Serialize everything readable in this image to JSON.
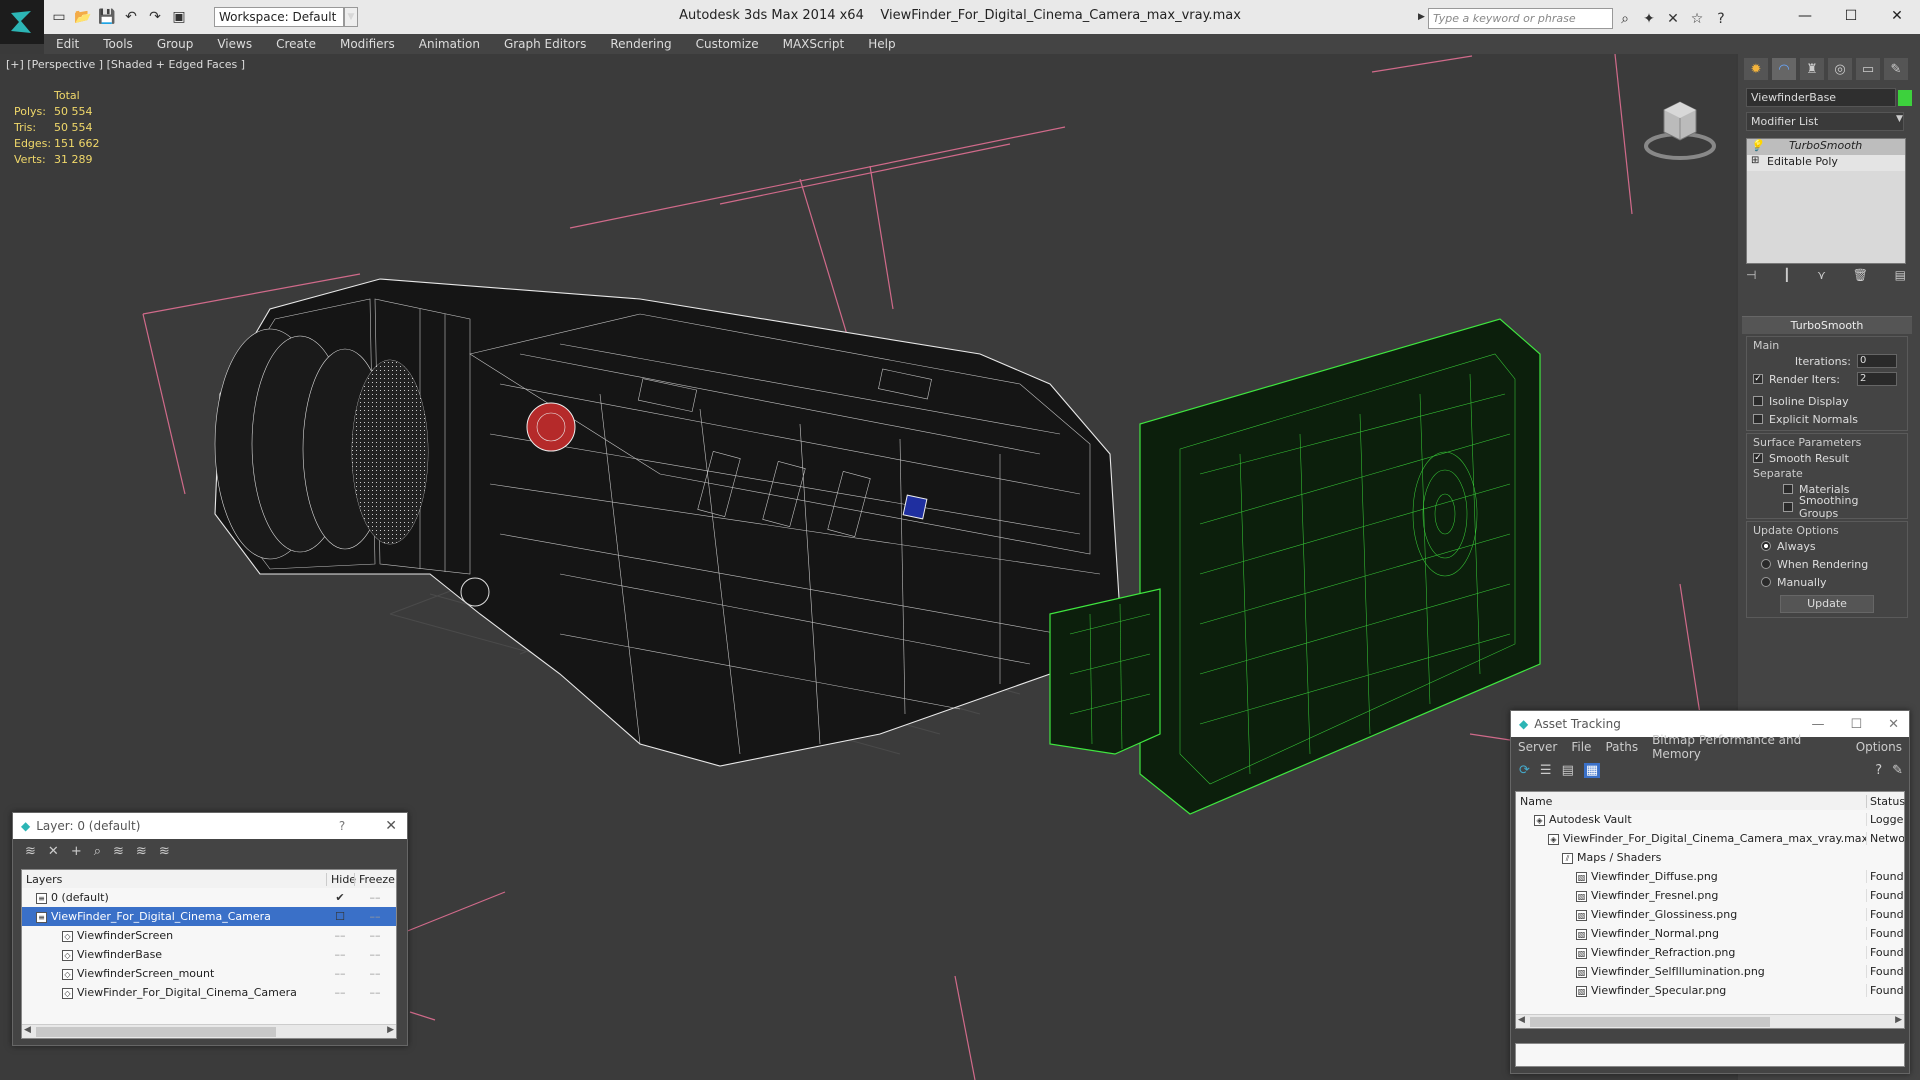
{
  "titlebar": {
    "workspace": "Workspace: Default",
    "app_name": "Autodesk 3ds Max  2014 x64",
    "file_name": "ViewFinder_For_Digital_Cinema_Camera_max_vray.max",
    "search_placeholder": "Type a keyword or phrase"
  },
  "menu": [
    "Edit",
    "Tools",
    "Group",
    "Views",
    "Create",
    "Modifiers",
    "Animation",
    "Graph Editors",
    "Rendering",
    "Customize",
    "MAXScript",
    "Help"
  ],
  "viewport": {
    "label": "[+] [Perspective ] [Shaded + Edged Faces ]",
    "stats": {
      "header": "Total",
      "rows": [
        {
          "label": "Polys:",
          "value": "50 554"
        },
        {
          "label": "Tris:",
          "value": "50 554"
        },
        {
          "label": "Edges:",
          "value": "151 662"
        },
        {
          "label": "Verts:",
          "value": "31 289"
        }
      ]
    }
  },
  "command_panel": {
    "object_name": "ViewfinderBase",
    "object_color": "#3dd13d",
    "modifier_list": "Modifier List",
    "stack": [
      "TurboSmooth",
      "Editable Poly"
    ],
    "rollout_title": "TurboSmooth",
    "main_label": "Main",
    "iterations_label": "Iterations:",
    "iterations_value": "0",
    "render_iters_label": "Render Iters:",
    "render_iters_value": "2",
    "isoline": "Isoline Display",
    "explicit_normals": "Explicit Normals",
    "surface_params": "Surface Parameters",
    "smooth_result": "Smooth Result",
    "separate": "Separate",
    "materials": "Materials",
    "smoothing_groups": "Smoothing Groups",
    "update_options": "Update Options",
    "always": "Always",
    "when_rendering": "When Rendering",
    "manually": "Manually",
    "update_button": "Update"
  },
  "layer_window": {
    "title": "Layer: 0 (default)",
    "help": "?",
    "col_layers": "Layers",
    "col_hide": "Hide",
    "col_freeze": "Freeze",
    "rows": [
      {
        "name": "0 (default)",
        "indent": 0
      },
      {
        "name": "ViewFinder_For_Digital_Cinema_Camera",
        "indent": 0
      },
      {
        "name": "ViewfinderScreen",
        "indent": 1
      },
      {
        "name": "ViewfinderBase",
        "indent": 1
      },
      {
        "name": "ViewfinderScreen_mount",
        "indent": 1
      },
      {
        "name": "ViewFinder_For_Digital_Cinema_Camera",
        "indent": 1
      }
    ]
  },
  "asset_window": {
    "title": "Asset Tracking",
    "menu": [
      "Server",
      "File",
      "Paths",
      "Bitmap Performance and Memory",
      "Options"
    ],
    "col_name": "Name",
    "col_status": "Status",
    "rows": [
      {
        "name": "Autodesk Vault",
        "status": "Logged",
        "indent": 1
      },
      {
        "name": "ViewFinder_For_Digital_Cinema_Camera_max_vray.max",
        "status": "Netwo",
        "indent": 2
      },
      {
        "name": "Maps / Shaders",
        "status": "",
        "indent": 3
      },
      {
        "name": "Viewfinder_Diffuse.png",
        "status": "Found",
        "indent": 4
      },
      {
        "name": "Viewfinder_Fresnel.png",
        "status": "Found",
        "indent": 4
      },
      {
        "name": "Viewfinder_Glossiness.png",
        "status": "Found",
        "indent": 4
      },
      {
        "name": "Viewfinder_Normal.png",
        "status": "Found",
        "indent": 4
      },
      {
        "name": "Viewfinder_Refraction.png",
        "status": "Found",
        "indent": 4
      },
      {
        "name": "Viewfinder_SelfIllumination.png",
        "status": "Found",
        "indent": 4
      },
      {
        "name": "Viewfinder_Specular.png",
        "status": "Found",
        "indent": 4
      }
    ]
  }
}
